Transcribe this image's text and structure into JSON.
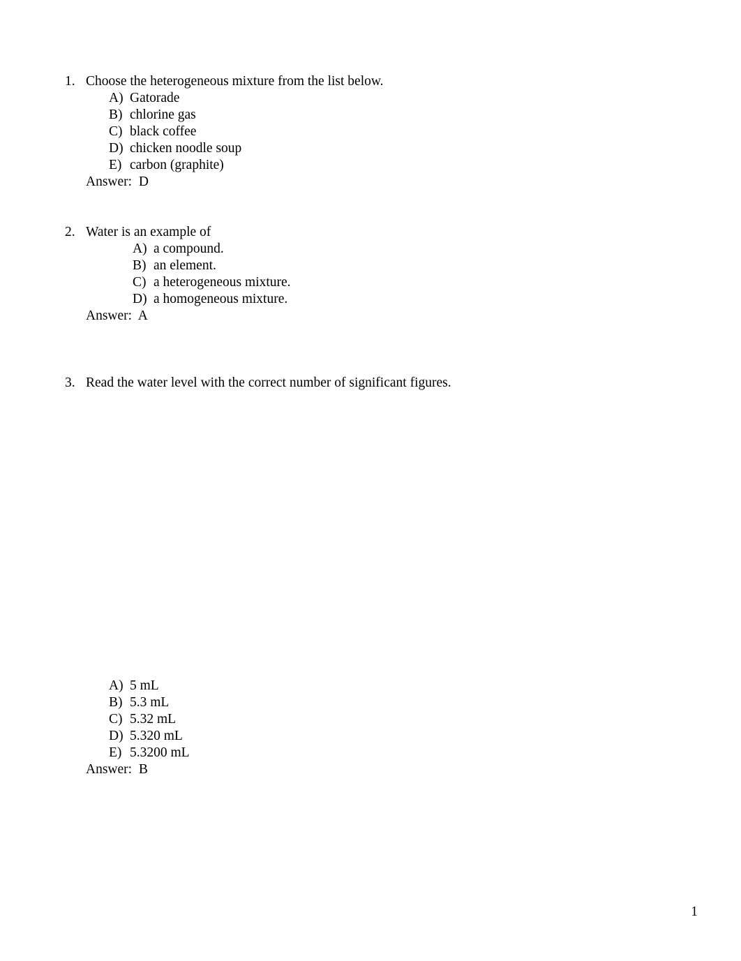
{
  "document": {
    "page_number": "1",
    "background_color": "#ffffff",
    "text_color": "#000000"
  },
  "questions": [
    {
      "number": "1.",
      "stem": "Choose the heterogeneous mixture from the list below.",
      "indent_level": 1,
      "options": [
        {
          "letter": "A)",
          "text": "Gatorade"
        },
        {
          "letter": "B)",
          "text": "chlorine gas"
        },
        {
          "letter": "C)",
          "text": "black coffee"
        },
        {
          "letter": "D)",
          "text": "chicken noodle soup"
        },
        {
          "letter": "E)",
          "text": "carbon (graphite)"
        }
      ],
      "answer_label": "Answer:",
      "answer_value": "D",
      "has_figure": false
    },
    {
      "number": "2.",
      "stem": "Water is an example of",
      "indent_level": 2,
      "options": [
        {
          "letter": "A)",
          "text": "a compound."
        },
        {
          "letter": "B)",
          "text": "an element."
        },
        {
          "letter": "C)",
          "text": "a heterogeneous mixture."
        },
        {
          "letter": "D)",
          "text": "a homogeneous mixture."
        }
      ],
      "answer_label": "Answer:",
      "answer_value": "A",
      "has_figure": false
    },
    {
      "number": "3.",
      "stem": "Read the water level with the correct number of significant figures.",
      "indent_level": 1,
      "options": [
        {
          "letter": "A)",
          "text": "5 mL"
        },
        {
          "letter": "B)",
          "text": "5.3 mL"
        },
        {
          "letter": "C)",
          "text": "5.32 mL"
        },
        {
          "letter": "D)",
          "text": "5.320 mL"
        },
        {
          "letter": "E)",
          "text": "5.3200 mL"
        }
      ],
      "answer_label": "Answer:",
      "answer_value": "B",
      "has_figure": true,
      "figure_caption": ""
    }
  ]
}
